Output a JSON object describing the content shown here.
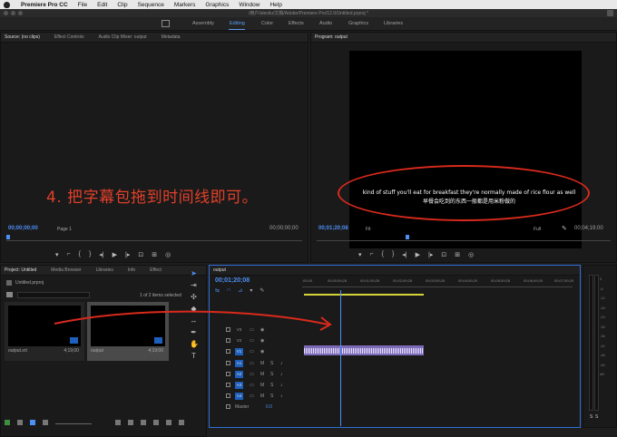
{
  "menubar": {
    "app_name": "Premiere Pro CC",
    "items": [
      "File",
      "Edit",
      "Clip",
      "Sequence",
      "Markers",
      "Graphics",
      "Window",
      "Help"
    ]
  },
  "path": "/用户/alexliu/文稿/Adobe/Premiere Pro/12.0/Untitled.prproj *",
  "workspaces": [
    "Assembly",
    "Editing",
    "Color",
    "Effects",
    "Audio",
    "Graphics",
    "Libraries"
  ],
  "workspace_active": "Editing",
  "source_panel": {
    "tabs": [
      "Source: (no clips)",
      "Effect Controls",
      "Audio Clip Mixer: output",
      "Metadata"
    ],
    "timecode_left": "00;00;00;00",
    "page_select": "Page 1",
    "timecode_right": "00;00;00;00"
  },
  "program_panel": {
    "tab": "Program: output",
    "timecode_left": "00;01;20;08",
    "fit_select": "Fit",
    "quality_select": "Full",
    "timecode_right": "00;04;19;00",
    "subtitle_en": "kind of stuff you'll eat for breakfast they're normally made of rice flour as well",
    "subtitle_zh": "早餐会吃到的东西一般都是用米粉做的"
  },
  "annotation": "4. 把字幕包拖到时间线即可。",
  "project_panel": {
    "tabs": [
      "Project: Untitled",
      "Media Browser",
      "Libraries",
      "Info",
      "Effect"
    ],
    "file": "Untitled.prproj",
    "items_selected": "1 of 2 items selected",
    "items": [
      {
        "name": "output.srt",
        "duration": "4;19;00"
      },
      {
        "name": "output",
        "duration": "4;19;00"
      }
    ]
  },
  "timeline_panel": {
    "tab": "output",
    "timecode": "00;01;20;08",
    "ruler_ticks": [
      ";00;00",
      "00;00;59;28",
      "00;01;59;28",
      "00;02;59;28",
      "00;03;59;28",
      "00;04;59;29",
      "00;05;59;28",
      "00;06;59;29",
      "00;07;59;29"
    ],
    "tracks": [
      {
        "label": "V3",
        "kind": "video"
      },
      {
        "label": "V2",
        "kind": "video"
      },
      {
        "label": "V1",
        "kind": "video"
      },
      {
        "label": "A1",
        "kind": "audio"
      },
      {
        "label": "A2",
        "kind": "audio"
      },
      {
        "label": "A3",
        "kind": "audio"
      },
      {
        "label": "A4",
        "kind": "audio"
      }
    ],
    "master_label": "Master",
    "master_value": "0.0",
    "toggle_m": "M",
    "toggle_s": "S"
  },
  "audio_meter": {
    "scale": [
      "0",
      "-6",
      "-12",
      "-18",
      "-24",
      "-30",
      "-36",
      "-42",
      "-48",
      "-54",
      "dB"
    ],
    "solo_labels": [
      "S",
      "S"
    ]
  },
  "colors": {
    "accent": "#4d8ff5",
    "annotation": "#e1402a",
    "clip": "#7c6bb8",
    "workbar": "#d5d53a"
  }
}
